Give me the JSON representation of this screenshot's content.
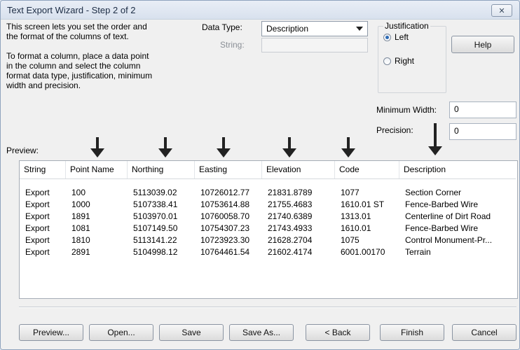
{
  "window": {
    "title": "Text Export Wizard - Step 2 of 2",
    "close_label": "✕"
  },
  "instructions": {
    "line1": "This screen lets you set the order and",
    "line2": "the format of the columns of text.",
    "para2_line1": "To format a column, place a data point",
    "para2_line2": "in the column and select the column",
    "para2_line3": "format data type, justification, minimum",
    "para2_line4": "width and precision."
  },
  "data_type": {
    "label": "Data Type:",
    "value": "Description",
    "string_label": "String:",
    "string_value": ""
  },
  "justification": {
    "label": "Justification",
    "options": [
      "Left",
      "Right"
    ],
    "selected": "Left"
  },
  "help_label": "Help",
  "minimum_width": {
    "label": "Minimum Width:",
    "value": "0"
  },
  "precision": {
    "label": "Precision:",
    "value": "0"
  },
  "preview_label": "Preview:",
  "table": {
    "columns": [
      "String",
      "Point Name",
      "Northing",
      "Easting",
      "Elevation",
      "Code",
      "Description"
    ],
    "rows": [
      [
        "Export",
        "100",
        "5113039.02",
        "10726012.77",
        "21831.8789",
        "1077",
        "Section Corner"
      ],
      [
        "Export",
        "1000",
        "5107338.41",
        "10753614.88",
        "21755.4683",
        "1610.01 ST",
        "Fence-Barbed Wire"
      ],
      [
        "Export",
        "1891",
        "5103970.01",
        "10760058.70",
        "21740.6389",
        "1313.01",
        "Centerline of Dirt Road"
      ],
      [
        "Export",
        "1081",
        "5107149.50",
        "10754307.23",
        "21743.4933",
        "1610.01",
        "Fence-Barbed Wire"
      ],
      [
        "Export",
        "1810",
        "5113141.22",
        "10723923.30",
        "21628.2704",
        "1075",
        "Control Monument-Pr..."
      ],
      [
        "Export",
        "2891",
        "5104998.12",
        "10764461.54",
        "21602.4174",
        "6001.00170",
        "Terrain"
      ]
    ]
  },
  "buttons": {
    "preview": "Preview...",
    "open": "Open...",
    "save": "Save",
    "save_as": "Save As...",
    "back": "< Back",
    "finish": "Finish",
    "cancel": "Cancel"
  }
}
